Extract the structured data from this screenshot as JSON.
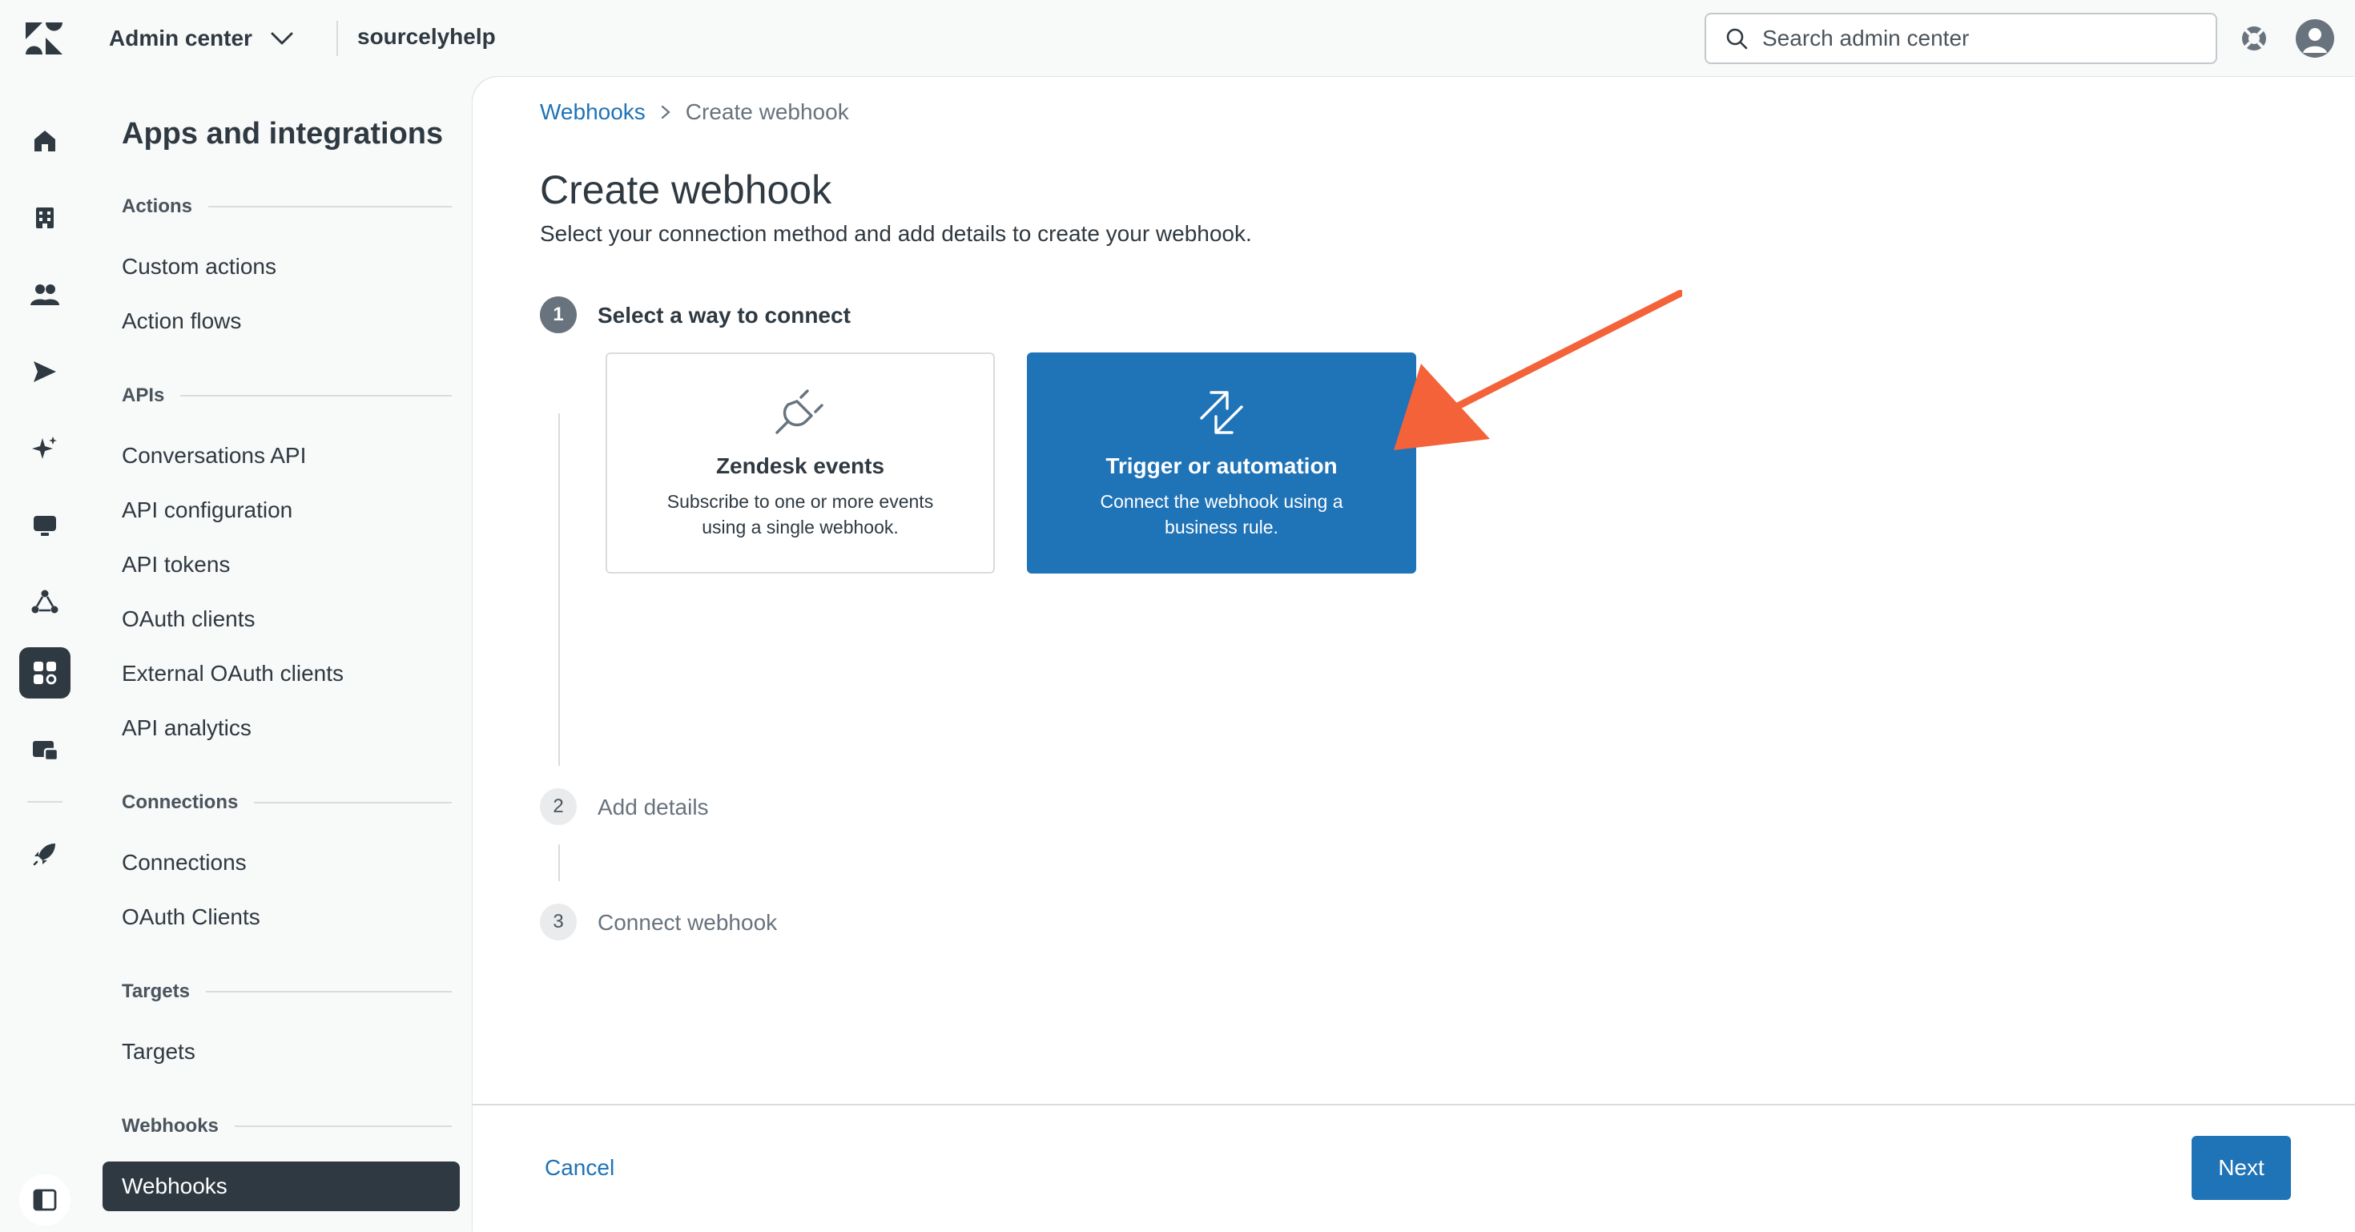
{
  "topbar": {
    "logo_icon": "zendesk-logo-icon",
    "product": "Admin center",
    "account": "sourcelyhelp",
    "search": {
      "placeholder": "Search admin center",
      "value": ""
    },
    "help_icon": "lifebuoy-icon",
    "avatar_icon": "user-avatar-icon"
  },
  "rail": {
    "items": [
      {
        "icon": "home-icon"
      },
      {
        "icon": "building-icon"
      },
      {
        "icon": "people-icon"
      },
      {
        "icon": "channels-send-icon"
      },
      {
        "icon": "ai-sparkle-icon"
      },
      {
        "icon": "workspaces-monitor-icon"
      },
      {
        "icon": "objects-rules-icon"
      },
      {
        "icon": "apps-integrations-icon",
        "active": true
      },
      {
        "icon": "account-billing-icon"
      },
      {
        "icon": "rocket-icon"
      }
    ],
    "collapse_icon": "sidebar-toggle-icon"
  },
  "subnav": {
    "title": "Apps and integrations",
    "sections": {
      "actions": {
        "heading": "Actions",
        "items": [
          "Custom actions",
          "Action flows"
        ]
      },
      "apis": {
        "heading": "APIs",
        "items": [
          "Conversations API",
          "API configuration",
          "API tokens",
          "OAuth clients",
          "External OAuth clients",
          "API analytics"
        ]
      },
      "connections": {
        "heading": "Connections",
        "items": [
          "Connections",
          "OAuth Clients"
        ]
      },
      "targets": {
        "heading": "Targets",
        "items": [
          "Targets"
        ]
      },
      "webhooks": {
        "heading": "Webhooks",
        "items": [
          "Webhooks"
        ]
      }
    }
  },
  "main": {
    "breadcrumb": {
      "parent": "Webhooks",
      "current": "Create webhook"
    },
    "title": "Create webhook",
    "subtitle": "Select your connection method and add details to create your webhook.",
    "steps": [
      {
        "number": "1",
        "label": "Select a way to connect",
        "state": "active"
      },
      {
        "number": "2",
        "label": "Add details",
        "state": "idle"
      },
      {
        "number": "3",
        "label": "Connect webhook",
        "state": "idle"
      }
    ],
    "options": [
      {
        "icon": "plug-icon",
        "title": "Zendesk events",
        "description": "Subscribe to one or more events using a single webhook.",
        "selected": false
      },
      {
        "icon": "arrows-exchange-icon",
        "title": "Trigger or automation",
        "description": "Connect the webhook using a business rule.",
        "selected": true
      }
    ],
    "annotation_arrow_color": "#f4623a"
  },
  "footer": {
    "cancel": "Cancel",
    "next": "Next"
  },
  "colors": {
    "accent": "#1f73b7",
    "text": "#2f3941",
    "muted": "#68737d",
    "active_nav": "#2f3941"
  }
}
